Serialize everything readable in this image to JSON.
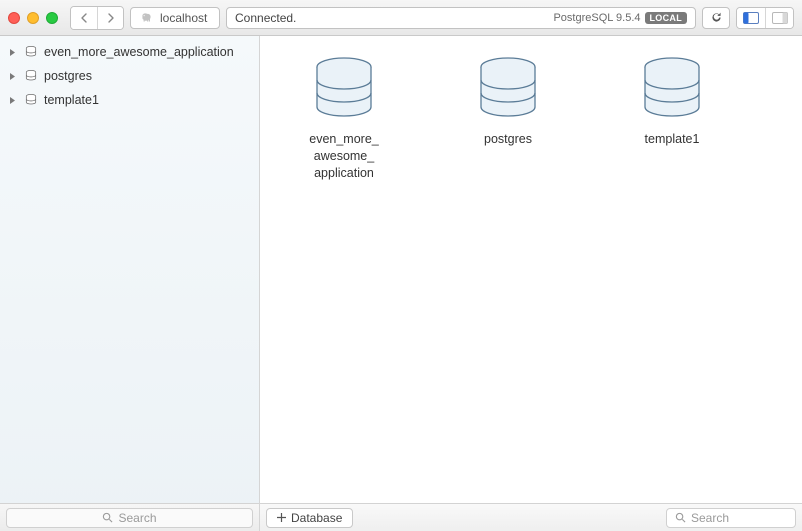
{
  "toolbar": {
    "host": "localhost",
    "status": "Connected.",
    "version": "PostgreSQL 9.5.4",
    "local_badge": "LOCAL"
  },
  "sidebar": {
    "items": [
      {
        "label": "even_more_awesome_application"
      },
      {
        "label": "postgres"
      },
      {
        "label": "template1"
      }
    ],
    "search_placeholder": "Search"
  },
  "main": {
    "databases": [
      {
        "label": "even_more_\nawesome_\napplication"
      },
      {
        "label": "postgres"
      },
      {
        "label": "template1"
      }
    ],
    "add_button": "Database",
    "search_placeholder": "Search"
  }
}
